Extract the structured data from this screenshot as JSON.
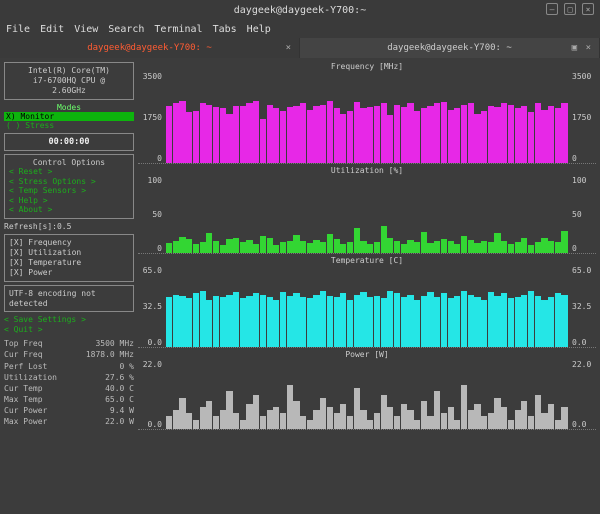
{
  "window": {
    "title": "daygeek@daygeek-Y700:~"
  },
  "menu": [
    "File",
    "Edit",
    "View",
    "Search",
    "Terminal",
    "Tabs",
    "Help"
  ],
  "tabs": [
    {
      "label": "daygeek@daygeek-Y700: ~",
      "active": true
    },
    {
      "label": "daygeek@daygeek-Y700: ~",
      "active": false
    }
  ],
  "cpu": {
    "line1": "Intel(R) Core(TM)",
    "line2": "i7-6700HQ CPU @",
    "line3": "2.60GHz"
  },
  "modes": {
    "title": "Modes",
    "monitor": "X) Monitor",
    "stress": "( ) Stress"
  },
  "timer": "00:00:00",
  "control": {
    "title": "Control Options",
    "items": [
      "< Reset          >",
      "< Stress Options >",
      "< Temp Sensors   >",
      "< Help           >",
      "< About          >"
    ]
  },
  "refresh": "Refresh[s]:0.5",
  "checks": [
    "[X] Frequency",
    "[X] Utilization",
    "[X] Temperature",
    "[X] Power"
  ],
  "utf8": "UTF-8 encoding not detected",
  "save": "< Save Settings  >",
  "quit": "< Quit           >",
  "stats": [
    {
      "k": "Top Freq",
      "v": "3500 MHz"
    },
    {
      "k": "Cur Freq",
      "v": "1878.0 MHz"
    },
    {
      "k": "Perf Lost",
      "v": "0 %"
    },
    {
      "k": "Utilization",
      "v": "27.6 %"
    },
    {
      "k": "Cur Temp",
      "v": "40.0 C"
    },
    {
      "k": "Max Temp",
      "v": "65.0 C"
    },
    {
      "k": "Cur Power",
      "v": "9.4 W"
    },
    {
      "k": "Max Power",
      "v": "22.0 W"
    }
  ],
  "chart_data": [
    {
      "type": "bar",
      "title": "Frequency [MHz]",
      "ylim": [
        0,
        3500
      ],
      "ticks": [
        "3500",
        "1750",
        "0"
      ],
      "values": [
        2200,
        2300,
        2400,
        1950,
        2000,
        2300,
        2250,
        2150,
        2100,
        1900,
        2200,
        2200,
        2300,
        2400,
        1700,
        2250,
        2100,
        2000,
        2150,
        2200,
        2300,
        2050,
        2200,
        2250,
        2400,
        2100,
        1900,
        2000,
        2350,
        2100,
        2150,
        2200,
        2300,
        1850,
        2250,
        2150,
        2300,
        2000,
        2100,
        2200,
        2300,
        2350,
        2050,
        2100,
        2250,
        2300,
        1900,
        2000,
        2200,
        2150,
        2300,
        2250,
        2100,
        2200,
        1950,
        2300,
        2050,
        2200,
        2100,
        2300
      ]
    },
    {
      "type": "bar",
      "title": "Utilization [%]",
      "ylim": [
        0,
        100
      ],
      "ticks": [
        "100",
        "50",
        "0"
      ],
      "values": [
        13,
        16,
        21,
        18,
        12,
        14,
        26,
        15,
        11,
        18,
        20,
        14,
        17,
        12,
        22,
        19,
        11,
        14,
        15,
        23,
        16,
        13,
        17,
        14,
        25,
        18,
        12,
        14,
        33,
        16,
        12,
        14,
        35,
        20,
        15,
        12,
        17,
        14,
        27,
        13,
        16,
        18,
        15,
        12,
        22,
        17,
        13,
        15,
        14,
        26,
        16,
        12,
        14,
        19,
        11,
        14,
        20,
        15,
        14,
        28
      ]
    },
    {
      "type": "bar",
      "title": "Temperature [C]",
      "ylim": [
        0,
        65
      ],
      "ticks": [
        "65.0",
        "32.5",
        "0.0"
      ],
      "values": [
        40,
        42,
        41,
        39,
        43,
        45,
        38,
        41,
        40,
        42,
        44,
        39,
        41,
        43,
        42,
        40,
        38,
        44,
        41,
        43,
        40,
        39,
        42,
        45,
        41,
        40,
        43,
        38,
        42,
        44,
        40,
        41,
        39,
        45,
        43,
        40,
        42,
        38,
        41,
        44,
        40,
        43,
        39,
        41,
        45,
        42,
        40,
        38,
        44,
        41,
        43,
        39,
        40,
        42,
        45,
        41,
        38,
        40,
        43,
        42
      ]
    },
    {
      "type": "bar",
      "title": "Power [W]",
      "ylim": [
        0,
        22
      ],
      "ticks": [
        "22.0",
        "0.0"
      ],
      "values": [
        4,
        6,
        10,
        5,
        3,
        7,
        9,
        4,
        6,
        12,
        5,
        3,
        8,
        11,
        4,
        6,
        7,
        5,
        14,
        9,
        4,
        3,
        6,
        10,
        7,
        5,
        8,
        4,
        13,
        6,
        3,
        5,
        11,
        7,
        4,
        8,
        6,
        3,
        9,
        4,
        12,
        5,
        7,
        3,
        14,
        6,
        8,
        4,
        5,
        10,
        7,
        3,
        6,
        9,
        4,
        11,
        5,
        8,
        3,
        7
      ]
    }
  ]
}
